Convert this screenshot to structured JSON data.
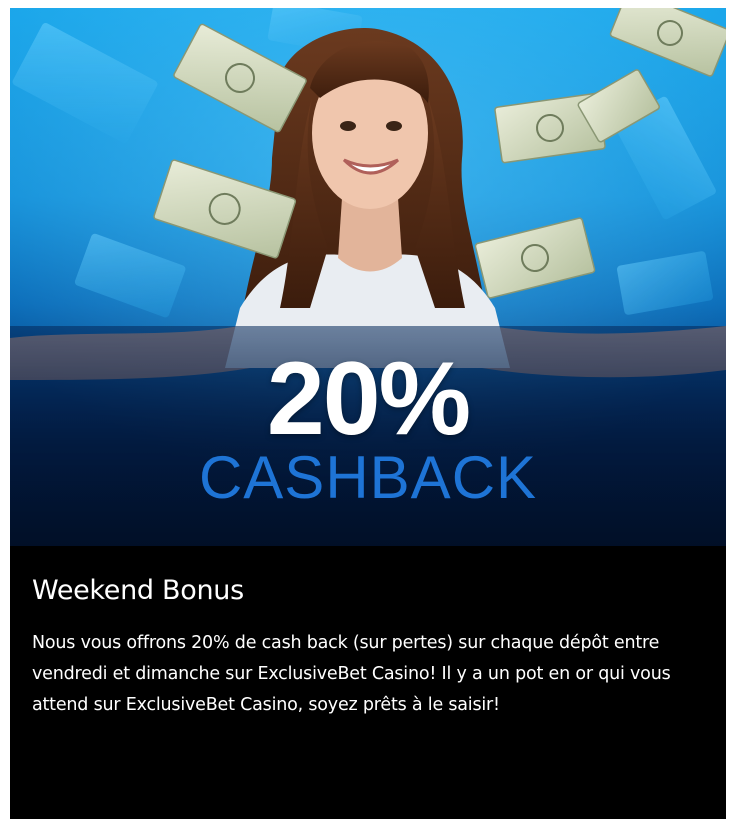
{
  "promo": {
    "headline_percent": "20%",
    "headline_word": "CASHBACK",
    "title": "Weekend Bonus",
    "description": "Nous vous offrons 20% de cash back (sur pertes) sur chaque dépôt entre vendredi et dimanche sur ExclusiveBet Casino! Il y a un pot en or qui vous attend sur ExclusiveBet Casino, soyez prêts à le saisir!"
  },
  "colors": {
    "hero_top": "#1aa6ea",
    "hero_bottom": "#021a3f",
    "accent_blue": "#1e74d6",
    "card_background": "#000000",
    "text": "#ffffff"
  },
  "icons": {
    "hero_image": "smiling-woman-with-flying-banknotes"
  }
}
